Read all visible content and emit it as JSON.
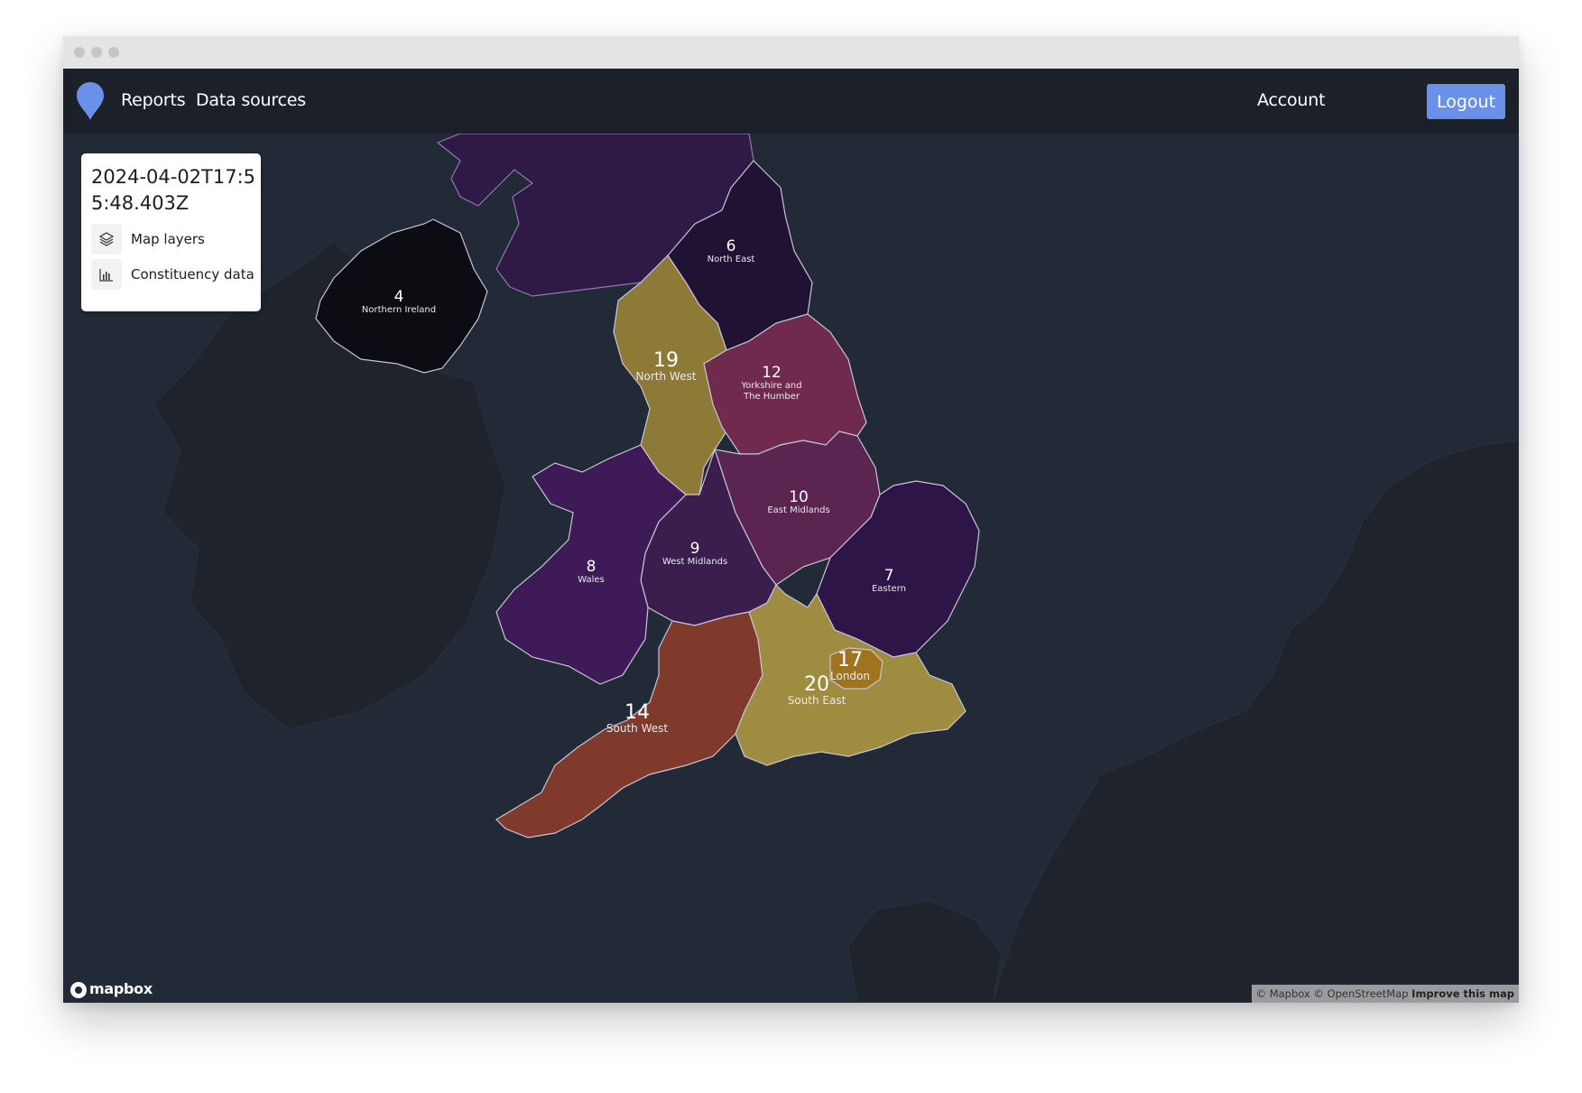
{
  "navbar": {
    "links": [
      "Reports",
      "Data sources"
    ],
    "account_label": "Account",
    "logout_label": "Logout",
    "brand_color": "#6a91ea"
  },
  "panel": {
    "title": "2024-04-02T17:55:48.403Z",
    "items": [
      {
        "label": "Map layers",
        "icon": "layers-icon"
      },
      {
        "label": "Constituency data",
        "icon": "bar-chart-icon"
      }
    ]
  },
  "map": {
    "regions": [
      {
        "name": "Northern Ireland",
        "value": "4",
        "color": "#0c0d12"
      },
      {
        "name": "North East",
        "value": "6",
        "color": "#1f1233"
      },
      {
        "name": "North West",
        "value": "19",
        "color": "#8c7a36"
      },
      {
        "name": "Yorkshire and The Humber",
        "value": "12",
        "color": "#6f2a4e"
      },
      {
        "name": "East Midlands",
        "value": "10",
        "color": "#5a2651"
      },
      {
        "name": "West Midlands",
        "value": "9",
        "color": "#3b1d4e"
      },
      {
        "name": "Wales",
        "value": "8",
        "color": "#3e1b56"
      },
      {
        "name": "Eastern",
        "value": "7",
        "color": "#2e1548"
      },
      {
        "name": "London",
        "value": "17",
        "color": "#a0741f"
      },
      {
        "name": "South East",
        "value": "20",
        "color": "#9e8c41"
      },
      {
        "name": "South West",
        "value": "14",
        "color": "#7f3a2c"
      }
    ],
    "scotland_color": "#2f1a47",
    "attribution": {
      "text": "© Mapbox © OpenStreetMap",
      "link": "Improve this map"
    },
    "logo_text": "mapbox"
  }
}
